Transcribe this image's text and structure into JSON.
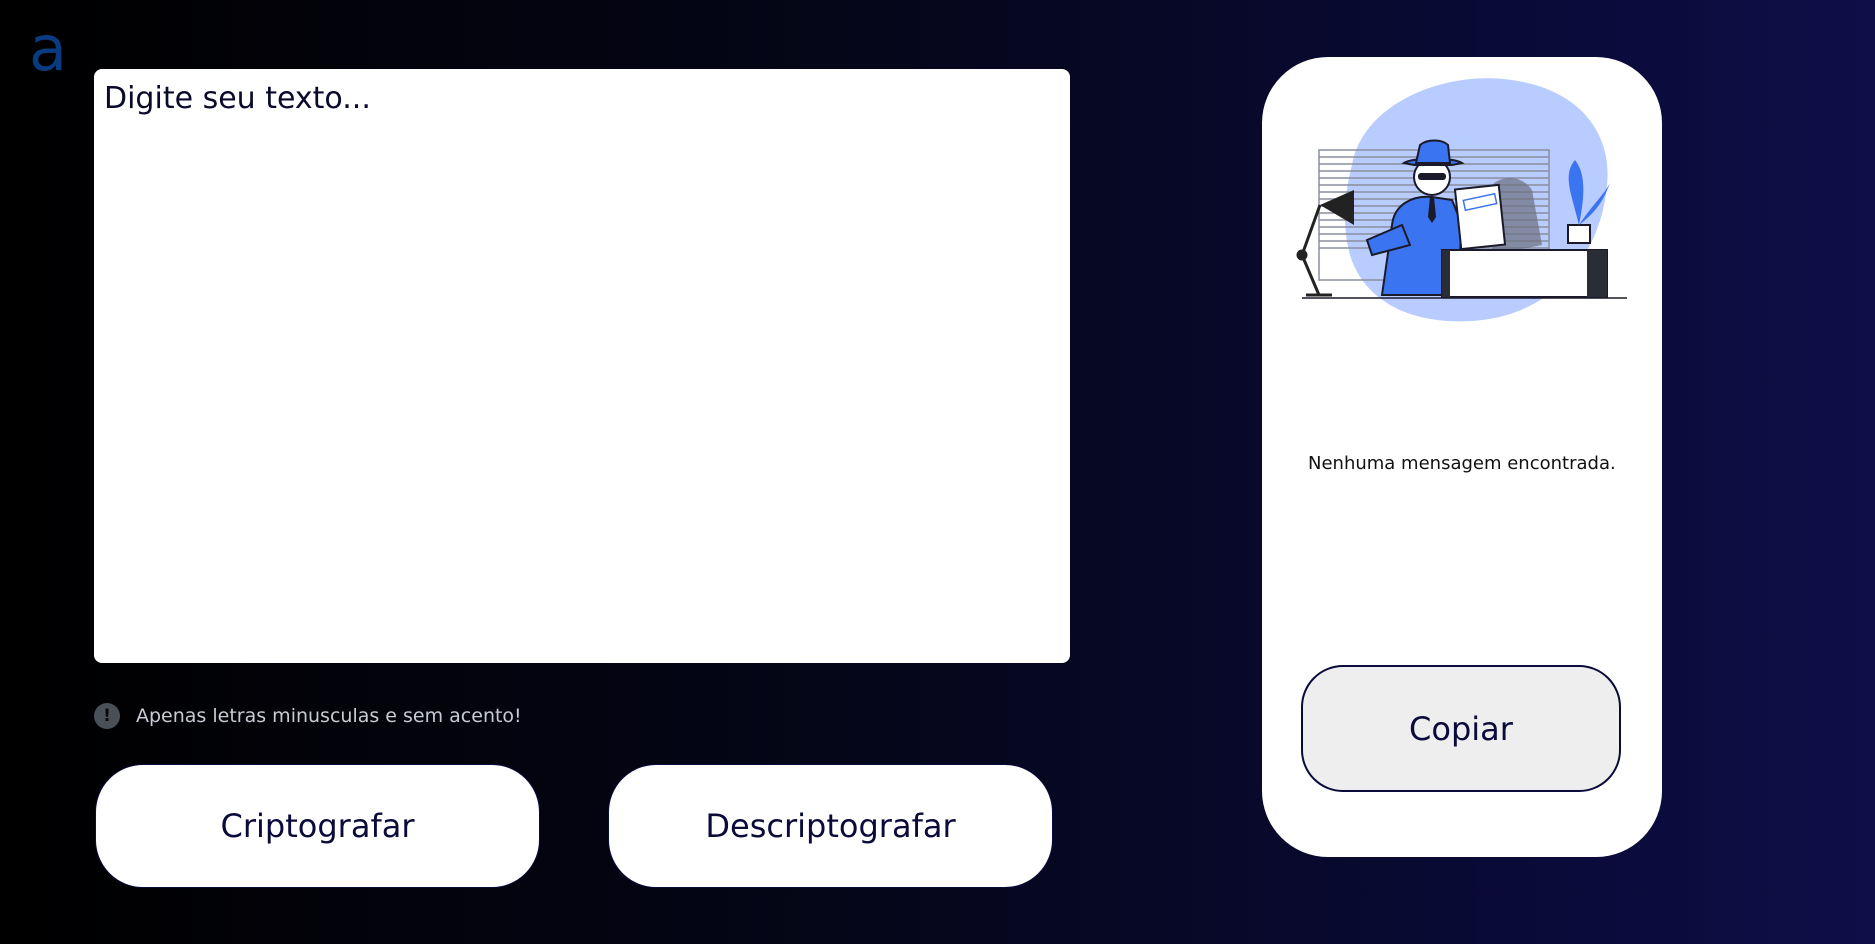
{
  "logo": {
    "icon": "alura-a-logo-icon",
    "letter": "a",
    "color": "#0a3a80"
  },
  "editor": {
    "placeholder": "Digite seu texto..."
  },
  "hint": {
    "icon": "exclamation-circle-icon",
    "text": "Apenas letras minusculas e sem acento!"
  },
  "actions": {
    "encrypt_label": "Criptografar",
    "decrypt_label": "Descriptografar"
  },
  "output": {
    "illustration": "detective-secret-document-illustration",
    "empty_message": "Nenhuma mensagem encontrada.",
    "copy_label": "Copiar"
  },
  "colors": {
    "primary": "#0a0b3a",
    "accent_blue": "#3b74f0",
    "light_blue": "#b9ccff",
    "panel_bg": "#ffffff"
  }
}
